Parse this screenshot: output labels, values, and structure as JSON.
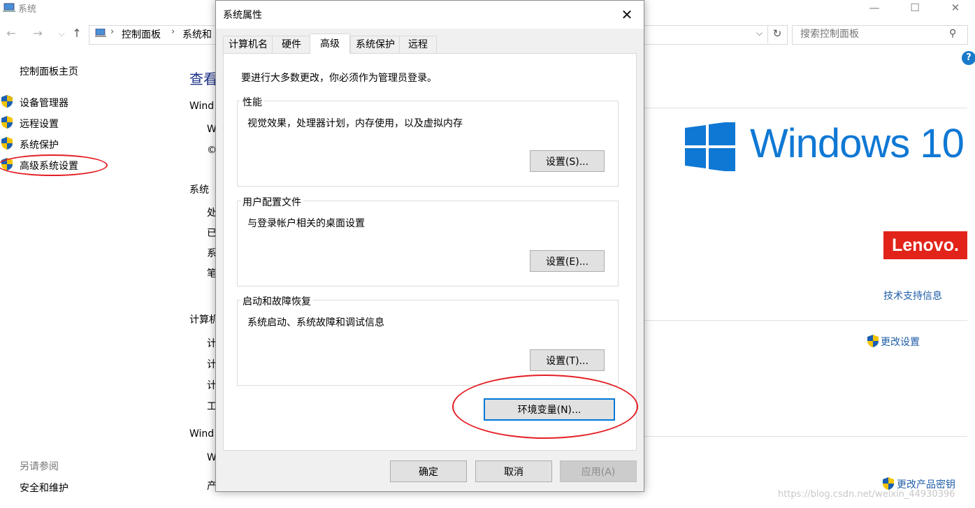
{
  "background_window": {
    "title": "系统",
    "nav": {
      "back": "←",
      "forward": "→",
      "recent": "⌵",
      "up": "↑"
    },
    "breadcrumb": [
      "控制面板",
      "系统和"
    ],
    "breadcrumb_sep": "›",
    "search_placeholder": "搜索控制面板",
    "help_label": "?",
    "left_nav": {
      "home": "控制面板主页",
      "items": [
        "设备管理器",
        "远程设置",
        "系统保护",
        "高级系统设置"
      ],
      "see_also_title": "另请参阅",
      "see_also_items": [
        "安全和维护"
      ]
    },
    "main": {
      "view_heading": "查看",
      "section_windows": "Wind",
      "windows_frags": [
        "W",
        "©"
      ],
      "section_system": "系统",
      "system_frags": [
        "处",
        "已",
        "系",
        "笔"
      ],
      "section_computer": "计算机",
      "computer_frags": [
        "计",
        "计",
        "计",
        "工"
      ],
      "section_activation": "Wind",
      "activation_frags": [
        "W",
        "产"
      ]
    },
    "windows_logo_text": "Windows 10",
    "lenovo_logo": "Lenovo.",
    "tech_support": "技术支持信息",
    "change_settings": "更改设置",
    "change_product_key": "更改产品密钥",
    "watermark": "https://blog.csdn.net/weixin_44930396"
  },
  "dialog": {
    "title": "系统属性",
    "close": "✕",
    "tabs": [
      "计算机名",
      "硬件",
      "高级",
      "系统保护",
      "远程"
    ],
    "active_tab": "高级",
    "admin_note": "要进行大多数更改，你必须作为管理员登录。",
    "groups": [
      {
        "title": "性能",
        "desc": "视觉效果，处理器计划，内存使用，以及虚拟内存",
        "button": "设置(S)..."
      },
      {
        "title": "用户配置文件",
        "desc": "与登录帐户相关的桌面设置",
        "button": "设置(E)..."
      },
      {
        "title": "启动和故障恢复",
        "desc": "系统启动、系统故障和调试信息",
        "button": "设置(T)..."
      }
    ],
    "env_button": "环境变量(N)...",
    "ok": "确定",
    "cancel": "取消",
    "apply": "应用(A)"
  }
}
